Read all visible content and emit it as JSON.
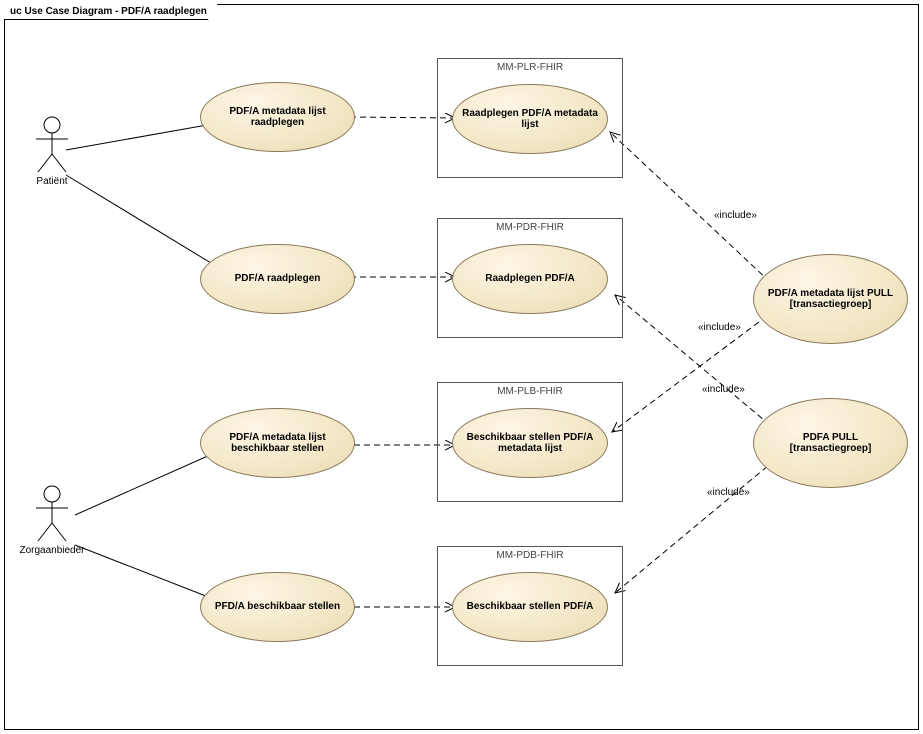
{
  "diagram": {
    "prefix": "uc",
    "title": "Use Case Diagram - PDF/A raadplegen"
  },
  "actors": {
    "patient": "Patiënt",
    "zorgaanbieder": "Zorgaanbieder"
  },
  "usecases": {
    "uc1": "PDF/A metadata lijst raadplegen",
    "uc2": "PDF/A raadplegen",
    "uc3": "PDF/A metadata lijst beschikbaar stellen",
    "uc4": "PFD/A beschikbaar stellen",
    "buc1": "Raadplegen PDF/A metadata lijst",
    "buc2": "Raadplegen PDF/A",
    "buc3": "Beschikbaar stellen PDF/A metadata lijst",
    "buc4": "Beschikbaar stellen PDF/A",
    "right1": "PDF/A metadata lijst PULL [transactiegroep]",
    "right2": "PDFA PULL [transactiegroep]"
  },
  "boundaries": {
    "b1": "MM-PLR-FHIR",
    "b2": "MM-PDR-FHIR",
    "b3": "MM-PLB-FHIR",
    "b4": "MM-PDB-FHIR"
  },
  "labels": {
    "include": "«include»"
  }
}
